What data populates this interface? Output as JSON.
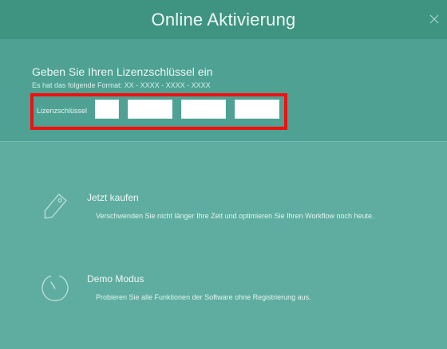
{
  "window": {
    "title": "Online Aktivierung",
    "close_icon": "close-icon"
  },
  "license": {
    "heading": "Geben Sie Ihren Lizenzschlüssel ein",
    "format_hint": "Es hat das folgende Format: XX - XXXX - XXXX - XXXX",
    "label": "Lizenzschlüssel",
    "fields": [
      "",
      "",
      "",
      ""
    ]
  },
  "options": {
    "buy": {
      "icon": "price-tag-icon",
      "title": "Jetzt kaufen",
      "description": "Verschwenden Sie nicht länger Ihre Zeit und optimieren Sie Ihren Workflow noch heute."
    },
    "demo": {
      "icon": "timer-icon",
      "title": "Demo Modus",
      "description": "Probieren Sie alle Funktionen der Software ohne Registrierung aus."
    }
  },
  "colors": {
    "titlebar": "#3f9481",
    "license_section": "#4ea193",
    "body": "#5fada0",
    "highlight": "#f01010"
  }
}
